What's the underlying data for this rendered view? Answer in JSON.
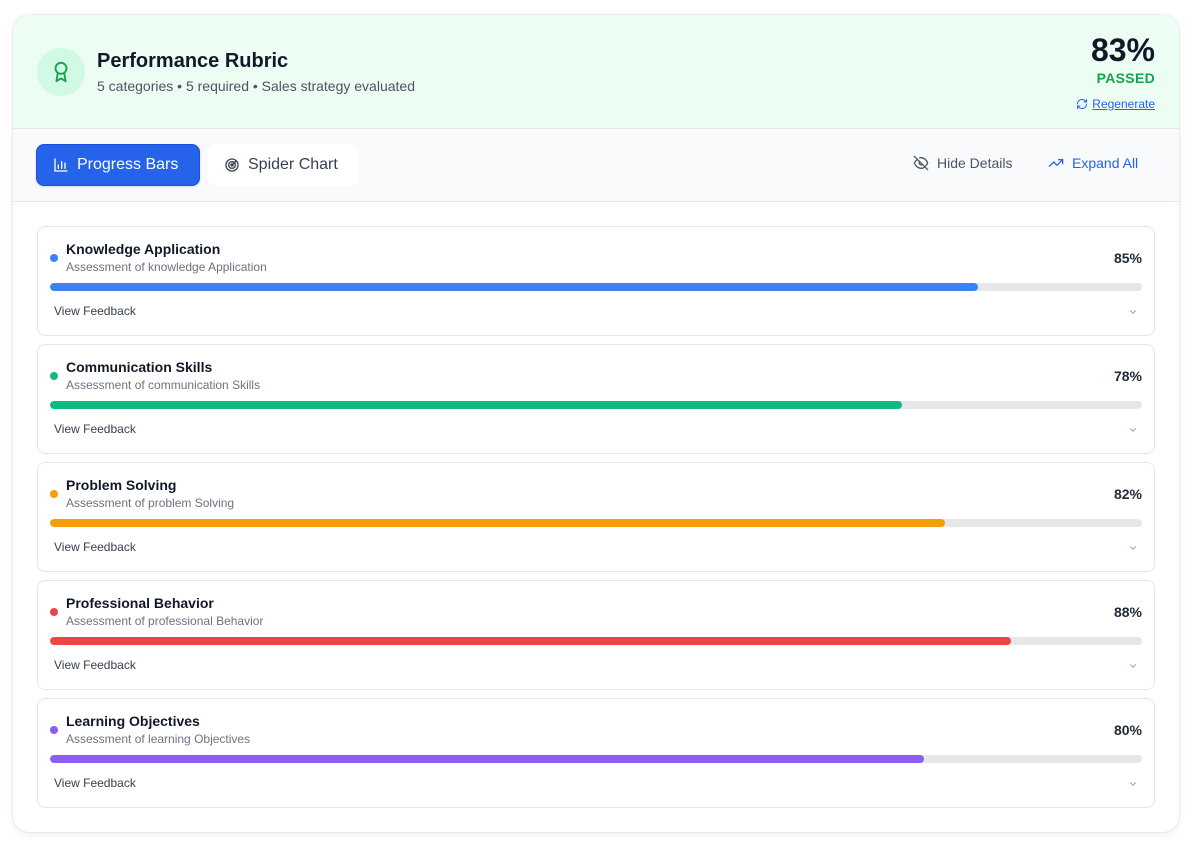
{
  "header": {
    "title": "Performance Rubric",
    "subtitle": "5 categories • 5 required • Sales strategy evaluated",
    "score": "83%",
    "status": "PASSED",
    "regenerate_label": "Regenerate",
    "badge_icon": "award-ribbon-icon"
  },
  "toolbar": {
    "tabs": [
      {
        "label": "Progress Bars",
        "icon": "bar-chart-icon",
        "active": true
      },
      {
        "label": "Spider Chart",
        "icon": "radar-icon",
        "active": false
      }
    ],
    "hide_details_label": "Hide Details",
    "expand_all_label": "Expand All"
  },
  "categories": [
    {
      "name": "Knowledge Application",
      "description": "Assessment of knowledge Application",
      "percent_label": "85%",
      "percent": 85,
      "color": "#3b82f6",
      "feedback_label": "View Feedback"
    },
    {
      "name": "Communication Skills",
      "description": "Assessment of communication Skills",
      "percent_label": "78%",
      "percent": 78,
      "color": "#10b981",
      "feedback_label": "View Feedback"
    },
    {
      "name": "Problem Solving",
      "description": "Assessment of problem Solving",
      "percent_label": "82%",
      "percent": 82,
      "color": "#f59e0b",
      "feedback_label": "View Feedback"
    },
    {
      "name": "Professional Behavior",
      "description": "Assessment of professional Behavior",
      "percent_label": "88%",
      "percent": 88,
      "color": "#ef4444",
      "feedback_label": "View Feedback"
    },
    {
      "name": "Learning Objectives",
      "description": "Assessment of learning Objectives",
      "percent_label": "80%",
      "percent": 80,
      "color": "#8b5cf6",
      "feedback_label": "View Feedback"
    }
  ],
  "colors": {
    "accent": "#2563eb",
    "pass": "#16a34a",
    "header_bg": "#ecfdf3"
  }
}
